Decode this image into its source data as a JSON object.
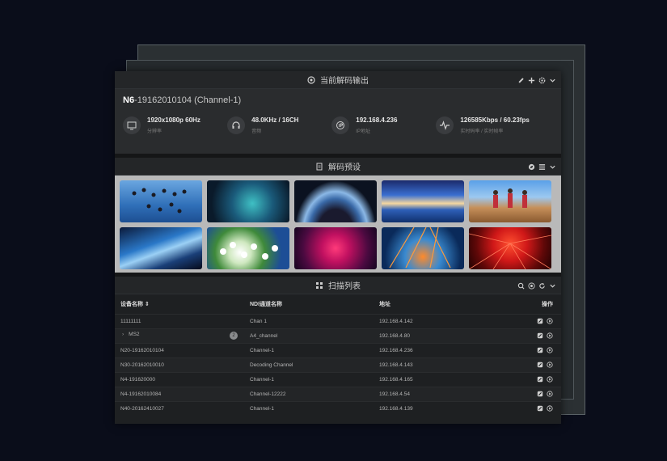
{
  "output": {
    "title": "当前解码输出",
    "device_model": "N6",
    "device_name": "-19162010104 (Channel-1)",
    "metrics": [
      {
        "icon": "monitor-icon",
        "value": "1920x1080p 60Hz",
        "label": "分辨率"
      },
      {
        "icon": "headphones-icon",
        "value": "48.0KHz / 16CH",
        "label": "音频"
      },
      {
        "icon": "ip-icon",
        "value": "192.168.4.236",
        "label": "IP地址"
      },
      {
        "icon": "pulse-icon",
        "value": "126585Kbps / 60.23fps",
        "label": "实时码率 / 实时帧率"
      }
    ]
  },
  "presets": {
    "title": "解码预设",
    "thumbnails": [
      "skydivers",
      "news-studio",
      "earth-from-space",
      "salt-flat-sunset",
      "marathon-runners",
      "satellite-over-earth",
      "lily-of-the-valley",
      "concert-lights-pink",
      "concert-lights-orange",
      "laser-show-red"
    ]
  },
  "scan": {
    "title": "扫描列表",
    "columns": {
      "name": "设备名称 ⇕",
      "ndi": "NDI通道名称",
      "addr": "地址",
      "op": "操作"
    },
    "rows": [
      {
        "name": "11111111",
        "ndi": "Chan 1",
        "addr": "192.168.4.142",
        "expand": "",
        "badge": ""
      },
      {
        "name": "MS2",
        "ndi": "A4_channel",
        "addr": "192.168.4.80",
        "expand": "›",
        "badge": "2"
      },
      {
        "name": "N20-19162010104",
        "ndi": "Channel-1",
        "addr": "192.168.4.236",
        "expand": "",
        "badge": ""
      },
      {
        "name": "N30-20162010010",
        "ndi": "Decoding Channel",
        "addr": "192.168.4.143",
        "expand": "",
        "badge": ""
      },
      {
        "name": "N4-191620000",
        "ndi": "Channel-1",
        "addr": "192.168.4.165",
        "expand": "",
        "badge": ""
      },
      {
        "name": "N4-19162010084",
        "ndi": "Channel-12222",
        "addr": "192.168.4.54",
        "expand": "",
        "badge": ""
      },
      {
        "name": "N40-20162410027",
        "ndi": "Channel-1",
        "addr": "192.168.4.139",
        "expand": "",
        "badge": ""
      }
    ]
  },
  "colors": {
    "background": "#0a0d1a",
    "panel": "#1e2022",
    "accent": "#ffffff"
  }
}
